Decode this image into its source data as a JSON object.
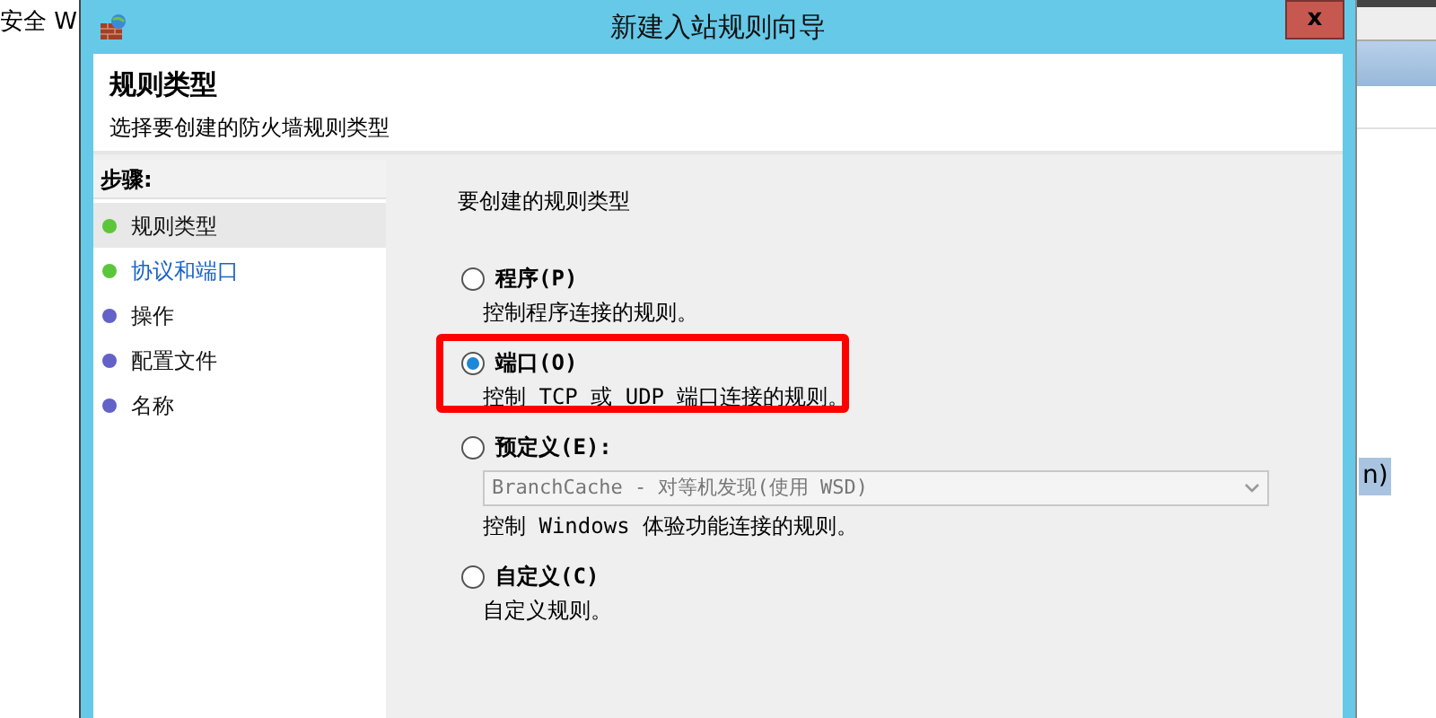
{
  "background_window": {
    "title_fragment": "安全 W",
    "column_fragment": "n)"
  },
  "window": {
    "title": "新建入站规则向导",
    "close": "x"
  },
  "header": {
    "title": "规则类型",
    "subtitle": "选择要创建的防火墙规则类型"
  },
  "steps": {
    "title": "步骤:",
    "items": [
      {
        "label": "规则类型",
        "selected": true,
        "hovered": false,
        "color": "#5cc63a"
      },
      {
        "label": "协议和端口",
        "selected": false,
        "hovered": true,
        "color": "#5cc63a"
      },
      {
        "label": "操作",
        "selected": false,
        "hovered": false,
        "color": "#6262c8"
      },
      {
        "label": "配置文件",
        "selected": false,
        "hovered": false,
        "color": "#6262c8"
      },
      {
        "label": "名称",
        "selected": false,
        "hovered": false,
        "color": "#6262c8"
      }
    ]
  },
  "prompt": "要创建的规则类型",
  "options": [
    {
      "label": "程序(P)",
      "description": "控制程序连接的规则。",
      "selected": false,
      "highlighted": false
    },
    {
      "label": "端口(O)",
      "description": "控制 TCP 或 UDP 端口连接的规则。",
      "selected": true,
      "highlighted": true
    },
    {
      "label": "预定义(E):",
      "description": "控制 Windows 体验功能连接的规则。",
      "selected": false,
      "highlighted": false,
      "dropdown": {
        "value": "BranchCache - 对等机发现(使用 WSD)",
        "disabled": true
      }
    },
    {
      "label": "自定义(C)",
      "description": "自定义规则。",
      "selected": false,
      "highlighted": false
    }
  ]
}
